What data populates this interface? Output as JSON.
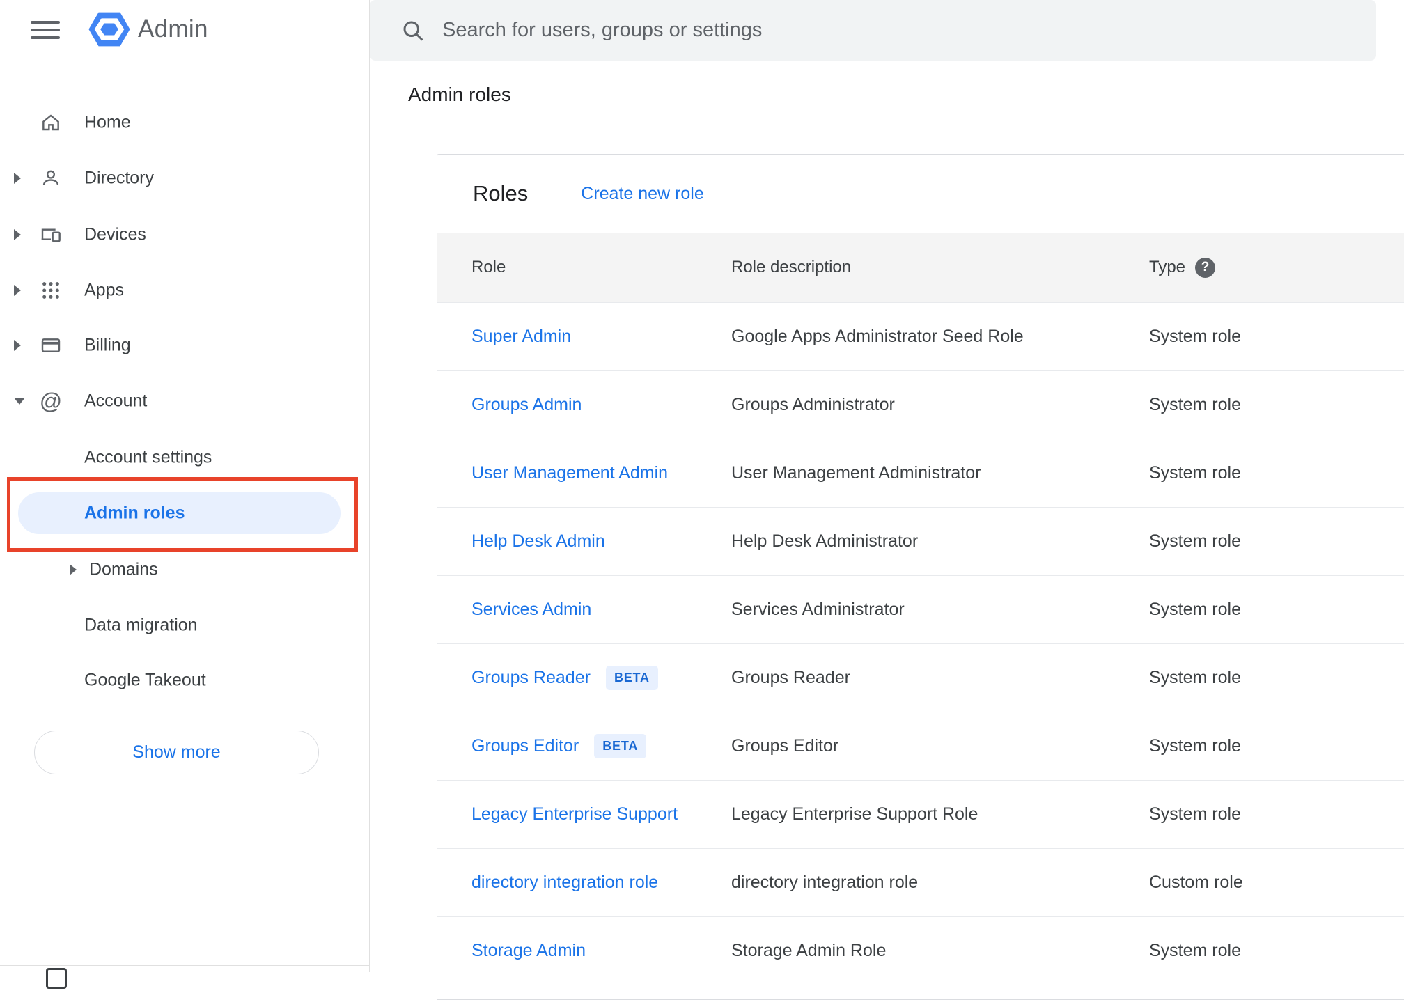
{
  "header": {
    "app_name": "Admin",
    "search_placeholder": "Search for users, groups or settings",
    "page_title": "Admin roles"
  },
  "sidebar": {
    "items": [
      {
        "label": "Home",
        "icon": "home-icon",
        "expandable": false
      },
      {
        "label": "Directory",
        "icon": "person-icon",
        "expandable": true
      },
      {
        "label": "Devices",
        "icon": "devices-icon",
        "expandable": true
      },
      {
        "label": "Apps",
        "icon": "apps-grid-icon",
        "expandable": true
      },
      {
        "label": "Billing",
        "icon": "credit-card-icon",
        "expandable": true
      },
      {
        "label": "Account",
        "icon": "at-sign-icon",
        "expanded": true
      }
    ],
    "children": [
      {
        "label": "Account settings",
        "active": false
      },
      {
        "label": "Admin roles",
        "active": true
      },
      {
        "label": "Domains",
        "expandable": true
      },
      {
        "label": "Data migration",
        "active": false
      },
      {
        "label": "Google Takeout",
        "active": false
      }
    ],
    "show_more_label": "Show more"
  },
  "roles_card": {
    "title": "Roles",
    "create_link_label": "Create new role",
    "columns": [
      "Role",
      "Role description",
      "Type"
    ],
    "beta_label": "BETA",
    "rows": [
      {
        "role": "Super Admin",
        "beta": false,
        "description": "Google Apps Administrator Seed Role",
        "type": "System role"
      },
      {
        "role": "Groups Admin",
        "beta": false,
        "description": "Groups Administrator",
        "type": "System role"
      },
      {
        "role": "User Management Admin",
        "beta": false,
        "description": "User Management Administrator",
        "type": "System role"
      },
      {
        "role": "Help Desk Admin",
        "beta": false,
        "description": "Help Desk Administrator",
        "type": "System role"
      },
      {
        "role": "Services Admin",
        "beta": false,
        "description": "Services Administrator",
        "type": "System role"
      },
      {
        "role": "Groups Reader",
        "beta": true,
        "description": "Groups Reader",
        "type": "System role"
      },
      {
        "role": "Groups Editor",
        "beta": true,
        "description": "Groups Editor",
        "type": "System role"
      },
      {
        "role": "Legacy Enterprise Support",
        "beta": false,
        "description": "Legacy Enterprise Support Role",
        "type": "System role"
      },
      {
        "role": "directory integration role",
        "beta": false,
        "description": "directory integration role",
        "type": "Custom role"
      },
      {
        "role": "Storage Admin",
        "beta": false,
        "description": "Storage Admin Role",
        "type": "System role"
      }
    ]
  },
  "colors": {
    "accent_blue": "#1a73e8",
    "link_blue": "#1a73e8",
    "beta_bg": "#e8f0fe",
    "beta_text": "#1967d2",
    "annotation_red": "#e8432a",
    "active_item_bg": "#e8f0fe",
    "search_bar_bg": "#f1f3f4",
    "table_header_bg": "#f4f4f4"
  }
}
